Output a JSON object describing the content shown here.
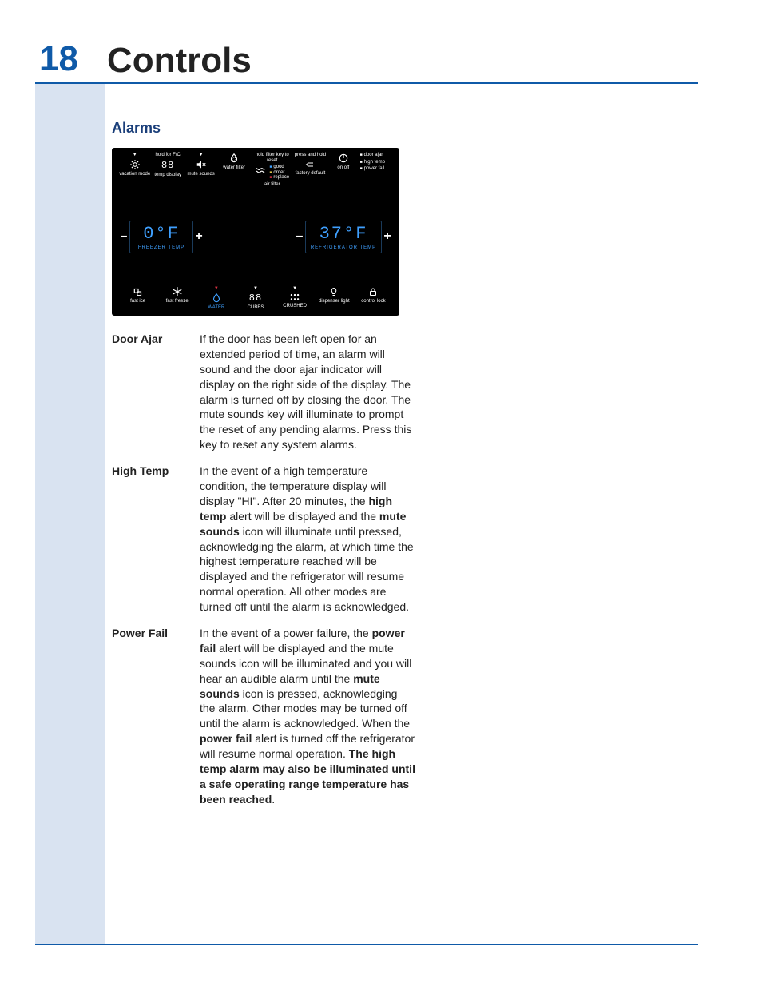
{
  "page_number": "18",
  "title": "Controls",
  "section": "Alarms",
  "panel": {
    "top_hints": {
      "hold_fc": "hold for F/C",
      "hold_filter": "hold filter key to reset",
      "press_hold": "press and hold"
    },
    "top_row": [
      {
        "label": "vacation mode"
      },
      {
        "label": "temp display",
        "seg": "88"
      },
      {
        "label": "mute sounds"
      },
      {
        "label": "water filter"
      },
      {
        "label": "air filter",
        "status": [
          "good",
          "order",
          "replace"
        ]
      },
      {
        "label": "factory default"
      },
      {
        "label": "on off"
      },
      {
        "label_list": [
          "door ajar",
          "high temp",
          "power fail"
        ]
      }
    ],
    "mid": {
      "freezer": {
        "value": "0°F",
        "label": "FREEZER TEMP"
      },
      "fridge": {
        "value": "37°F",
        "label": "REFRIGERATOR TEMP"
      }
    },
    "bottom_row": [
      {
        "label": "fast ice"
      },
      {
        "label": "fast freeze"
      },
      {
        "label": "WATER",
        "selected": true
      },
      {
        "label": "CUBES",
        "seg": "88"
      },
      {
        "label": "CRUSHED"
      },
      {
        "label": "dispenser light"
      },
      {
        "label": "control lock"
      }
    ]
  },
  "definitions": [
    {
      "term": "Door Ajar",
      "html": "If the door has been left open for an extended period of time, an alarm will sound and the door ajar indicator will display on the right side of the display. The alarm is turned off by closing the door. The mute sounds key will illuminate to prompt the reset of any pending alarms. Press this key to reset any system alarms."
    },
    {
      "term": "High Temp",
      "html": "In the event of a high temperature condition, the temperature display will display \"HI\". After 20 minutes, the <b>high temp</b> alert will be displayed and the <b>mute sounds</b> icon will illuminate until pressed, acknowledging the alarm, at which time the highest temperature reached will be displayed and the refrigerator will resume normal operation. All other modes are turned off until the alarm is acknowledged."
    },
    {
      "term": "Power Fail",
      "html": "In the event of a power failure, the <b>power fail</b> alert will be displayed and the mute sounds icon will be illuminated and you will hear an audible alarm until the <b>mute sounds</b> icon is pressed, acknowledging the alarm. Other modes may be turned off until the alarm is acknowledged. When the <b>power fail</b> alert is turned off the refrigerator will resume normal operation. <b>The high temp alarm may also be illuminated until a safe operating range temperature has been reached</b>."
    }
  ]
}
